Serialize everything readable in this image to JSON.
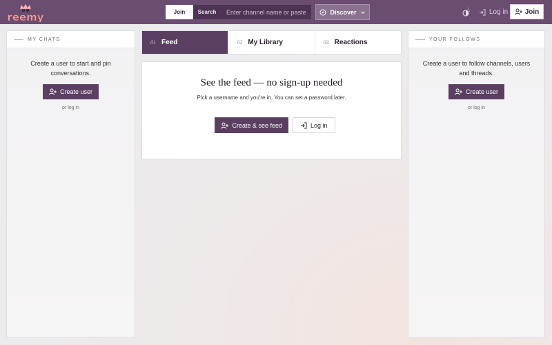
{
  "brand": {
    "logo_text": "reemy",
    "logo_color": "#e8a0a8"
  },
  "header": {
    "mode_join": "Join",
    "mode_search": "Search",
    "search_placeholder": "Enter channel name or paste ir",
    "discover_label": "Discover",
    "login_label": "Log in",
    "join_label": "Join"
  },
  "left_panel": {
    "title": "MY CHATS",
    "text": "Create a user to start and pin conversations.",
    "button_label": "Create user",
    "login_link": "or log in"
  },
  "tabs": [
    {
      "num": "01",
      "label": "Feed",
      "active": true
    },
    {
      "num": "02",
      "label": "My Library",
      "active": false
    },
    {
      "num": "03",
      "label": "Reactions",
      "active": false
    }
  ],
  "feed": {
    "title": "See the feed — no sign-up needed",
    "subtitle": "Pick a username and you're in. You can set a password later.",
    "primary_button": "Create & see feed",
    "secondary_button": "Log in"
  },
  "right_panel": {
    "title": "YOUR FOLLOWS",
    "text": "Create a user to follow channels, users and threads.",
    "button_label": "Create user",
    "login_link": "or log in"
  },
  "colors": {
    "topbar": "#6b4d72",
    "accent": "#5b3f62"
  },
  "icons": {
    "discover": "compass-icon",
    "discover_chevron": "chevron-down-icon",
    "theme": "theme-icon",
    "login": "login-icon",
    "add_user": "add-user-icon"
  }
}
